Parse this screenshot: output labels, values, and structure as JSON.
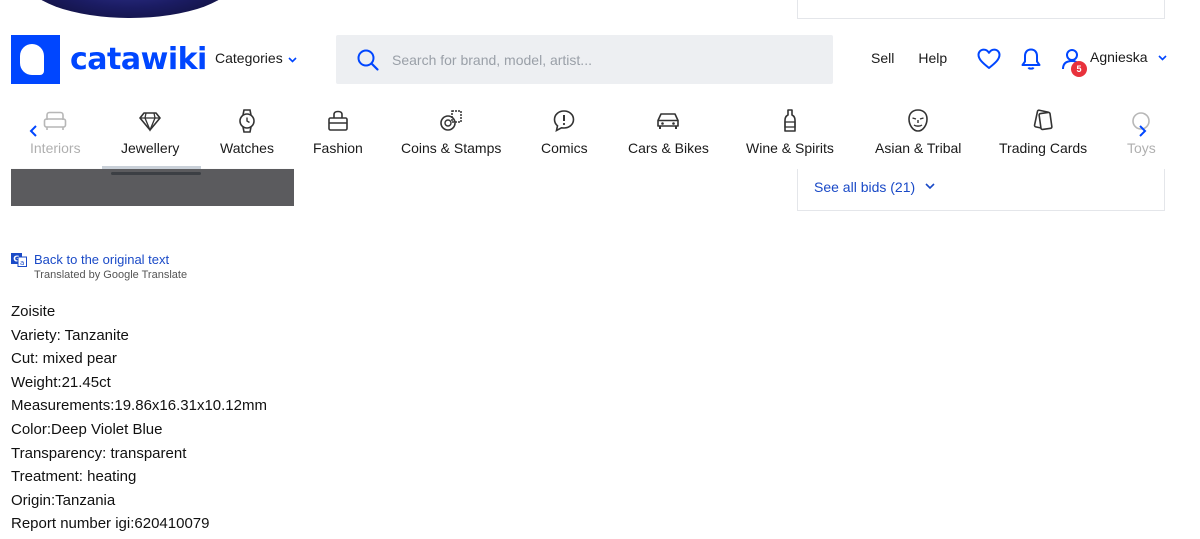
{
  "header": {
    "logo_text": "catawiki",
    "categories_label": "Categories",
    "search_placeholder": "Search for brand, model, artist...",
    "sell_label": "Sell",
    "help_label": "Help",
    "user_name": "Agnieska",
    "notification_count": "5",
    "icons": [
      "search-icon",
      "heart-icon",
      "bell-icon",
      "user-icon",
      "chevron-down-icon"
    ],
    "accent_color": "#0046ff",
    "badge_color": "#e8323c"
  },
  "category_nav": {
    "items": [
      {
        "label": "Interiors",
        "icon": "sofa-icon"
      },
      {
        "label": "Jewellery",
        "icon": "diamond-icon"
      },
      {
        "label": "Watches",
        "icon": "watch-icon"
      },
      {
        "label": "Fashion",
        "icon": "bag-icon"
      },
      {
        "label": "Coins & Stamps",
        "icon": "coins-icon"
      },
      {
        "label": "Comics",
        "icon": "speech-bubble-icon"
      },
      {
        "label": "Cars & Bikes",
        "icon": "car-icon"
      },
      {
        "label": "Wine & Spirits",
        "icon": "bottle-icon"
      },
      {
        "label": "Asian & Tribal",
        "icon": "mask-icon"
      },
      {
        "label": "Trading Cards",
        "icon": "cards-icon"
      },
      {
        "label": "Toys",
        "icon": "toy-icon"
      }
    ],
    "active": "Jewellery"
  },
  "bids": {
    "see_all_label": "See all bids (21)"
  },
  "translation": {
    "back_link": "Back to the original text",
    "credit": "Translated by Google Translate"
  },
  "description": {
    "lines": [
      "Zoisite",
      "Variety: Tanzanite",
      "Cut: mixed pear",
      "Weight:21.45ct",
      "Measurements:19.86x16.31x10.12mm",
      "Color:Deep Violet Blue",
      "Transparency: transparent",
      "Treatment: heating",
      "Origin:Tanzania",
      "Report number igi:620410079"
    ]
  }
}
